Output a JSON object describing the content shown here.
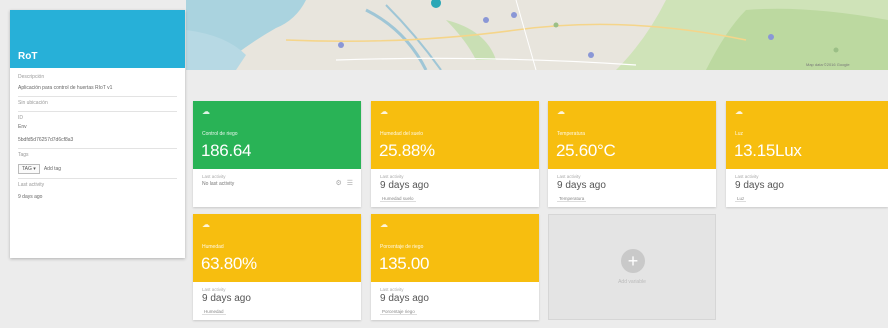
{
  "device": {
    "title": "RoT",
    "description_label": "Descripción",
    "description": "Aplicación para control de huertas RIoT v1",
    "location_label": "Sin ubicación",
    "id_label": "ID",
    "id_sub_label": "Env",
    "token": "5bdfd5d76257d7d6cf8a3",
    "tags_label": "Tags",
    "tag_select": "TAG",
    "tag_add_label": "Add tag",
    "last_activity_label": "Last activity",
    "last_activity": "9 days ago"
  },
  "tiles": [
    {
      "name": "Control de riego",
      "value": "186.64",
      "color": "green",
      "bottom_label": "Last activity",
      "bottom_value": "No last activity",
      "tag": ""
    },
    {
      "name": "Humedad del suelo",
      "value": "25.88%",
      "color": "yellow",
      "bottom_label": "Last activity",
      "bottom_value": "9 days ago",
      "tag": "Humedad suelo"
    },
    {
      "name": "Temperatura",
      "value": "25.60°C",
      "color": "yellow",
      "bottom_label": "Last activity",
      "bottom_value": "9 days ago",
      "tag": "Temperatura"
    },
    {
      "name": "Luz",
      "value": "13.15Lux",
      "color": "yellow",
      "bottom_label": "Last activity",
      "bottom_value": "9 days ago",
      "tag": "Luz"
    },
    {
      "name": "Humedad",
      "value": "63.80%",
      "color": "yellow",
      "bottom_label": "Last activity",
      "bottom_value": "9 days ago",
      "tag": "Humedad"
    },
    {
      "name": "Porcentaje de riego",
      "value": "135.00",
      "color": "yellow",
      "bottom_label": "Last activity",
      "bottom_value": "9 days ago",
      "tag": "Porcentaje riego"
    }
  ],
  "add_variable": {
    "label": "Add variable"
  },
  "map": {
    "attribution": "Map data ©2016 Google"
  },
  "icons": {
    "tile": "cloud-icon",
    "add": "plus-icon"
  },
  "colors": {
    "header": "#27b0d8",
    "green": "#29b356",
    "yellow": "#f7be0f"
  }
}
